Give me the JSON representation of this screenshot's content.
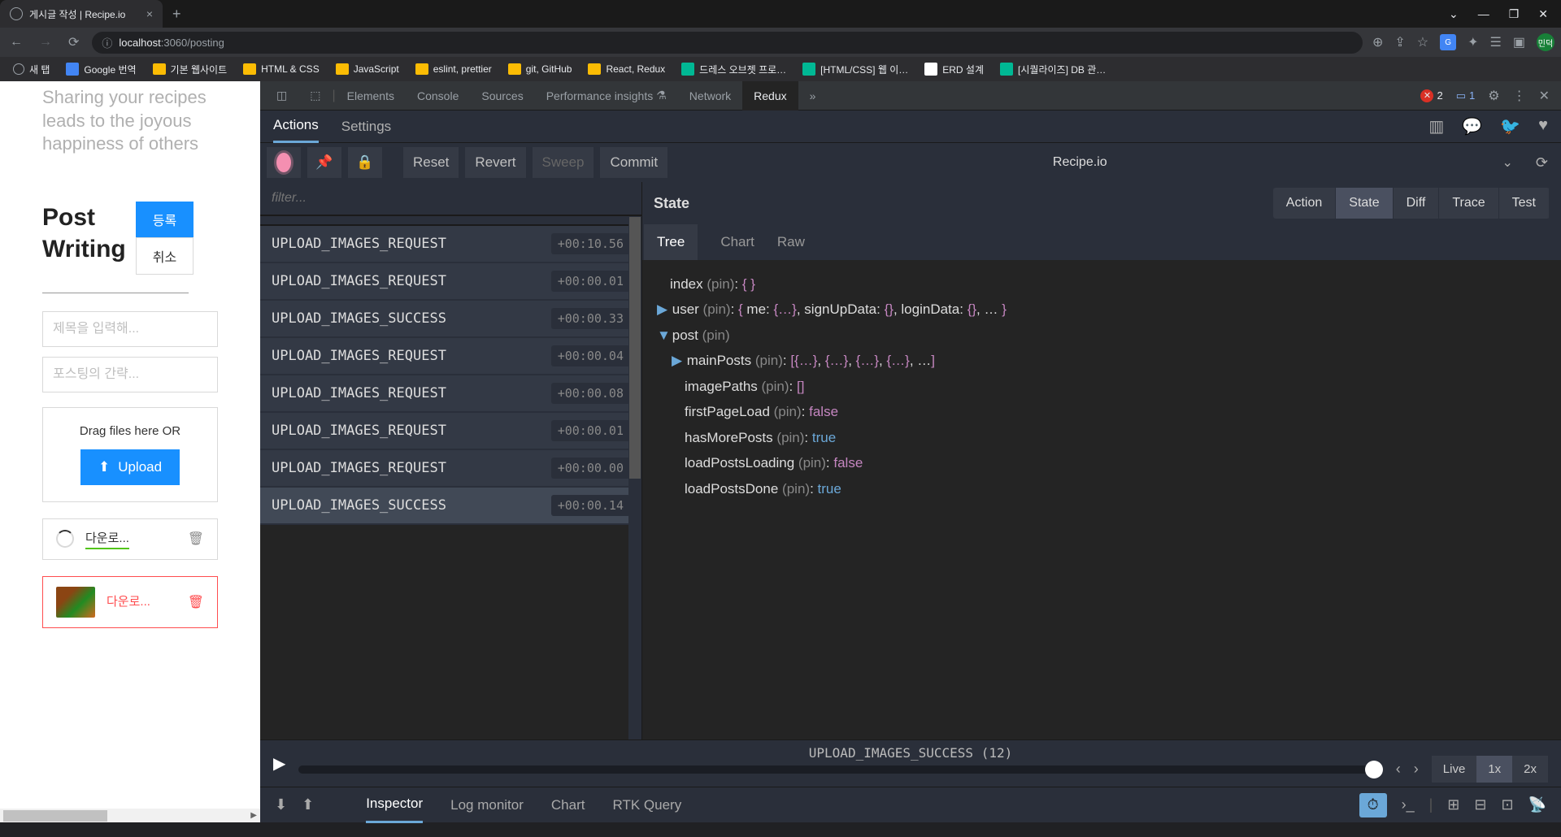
{
  "browser": {
    "tab_title": "게시글 작성 | Recipe.io",
    "url_host": "localhost",
    "url_port": ":3060",
    "url_path": "/posting",
    "avatar_text": "민덕",
    "bookmarks": [
      {
        "label": "새 탭",
        "type": "page"
      },
      {
        "label": "Google 번역",
        "type": "icon-blue"
      },
      {
        "label": "기본 웹사이트",
        "type": "folder"
      },
      {
        "label": "HTML & CSS",
        "type": "folder"
      },
      {
        "label": "JavaScript",
        "type": "folder"
      },
      {
        "label": "eslint, prettier",
        "type": "folder"
      },
      {
        "label": "git, GitHub",
        "type": "folder"
      },
      {
        "label": "React, Redux",
        "type": "folder"
      },
      {
        "label": "드레스 오브젯 프로…",
        "type": "icon-green"
      },
      {
        "label": "[HTML/CSS] 웹 이…",
        "type": "icon-green"
      },
      {
        "label": "ERD 설계",
        "type": "icon-doc"
      },
      {
        "label": "[시퀄라이즈] DB 관…",
        "type": "icon-green"
      }
    ]
  },
  "app": {
    "hero": "Sharing your recipes leads to the joyous happiness of others",
    "title_line1": "Post",
    "title_line2": "Writing",
    "btn_submit": "등록",
    "btn_cancel": "취소",
    "placeholder_title": "제목을 입력해...",
    "placeholder_summary": "포스팅의 간략...",
    "drag_text": "Drag files here OR",
    "upload_btn": "Upload",
    "file1": "다운로...",
    "file2": "다운로..."
  },
  "devtools": {
    "tabs": [
      "Elements",
      "Console",
      "Sources",
      "Performance insights",
      "Network",
      "Redux"
    ],
    "active_tab": "Redux",
    "errors": "2",
    "messages": "1",
    "redux_tabs": [
      "Actions",
      "Settings"
    ],
    "toolbar": {
      "reset": "Reset",
      "revert": "Revert",
      "sweep": "Sweep",
      "commit": "Commit",
      "app_name": "Recipe.io"
    },
    "filter_placeholder": "filter...",
    "actions": [
      {
        "name": "UPLOAD_IMAGES_REQUEST",
        "time": "+00:10.56"
      },
      {
        "name": "UPLOAD_IMAGES_REQUEST",
        "time": "+00:00.01"
      },
      {
        "name": "UPLOAD_IMAGES_SUCCESS",
        "time": "+00:00.33"
      },
      {
        "name": "UPLOAD_IMAGES_REQUEST",
        "time": "+00:00.04"
      },
      {
        "name": "UPLOAD_IMAGES_REQUEST",
        "time": "+00:00.08"
      },
      {
        "name": "UPLOAD_IMAGES_REQUEST",
        "time": "+00:00.01"
      },
      {
        "name": "UPLOAD_IMAGES_REQUEST",
        "time": "+00:00.00"
      },
      {
        "name": "UPLOAD_IMAGES_SUCCESS",
        "time": "+00:00.14"
      }
    ],
    "state_header": "State",
    "view_tabs": [
      "Action",
      "State",
      "Diff",
      "Trace",
      "Test"
    ],
    "tree_tabs": [
      "Tree",
      "Chart",
      "Raw"
    ],
    "tree": {
      "l1": "index (pin): { }",
      "l2a": "user",
      "l2b": "(pin)",
      "l2c": ": { me: {…}, signUpData: {}, loginData: {}, … }",
      "l3a": "post",
      "l3b": "(pin)",
      "l4a": "mainPosts",
      "l4b": "(pin)",
      "l4c": ": [{…}, {…}, {…}, {…}, …]",
      "l5a": "imagePaths",
      "l5b": "(pin)",
      "l5c": ": []",
      "l6a": "firstPageLoad",
      "l6b": "(pin)",
      "l6c": ": ",
      "l6d": "false",
      "l7a": "hasMorePosts",
      "l7b": "(pin)",
      "l7c": ": ",
      "l7d": "true",
      "l8a": "loadPostsLoading",
      "l8b": "(pin)",
      "l8c": ": ",
      "l8d": "false",
      "l9a": "loadPostsDone",
      "l9b": "(pin)",
      "l9c": ": ",
      "l9d": "true"
    },
    "playback": {
      "label": "UPLOAD_IMAGES_SUCCESS (12)",
      "live": "Live",
      "s1x": "1x",
      "s2x": "2x"
    },
    "bottom_tabs": [
      "Inspector",
      "Log monitor",
      "Chart",
      "RTK Query"
    ]
  }
}
